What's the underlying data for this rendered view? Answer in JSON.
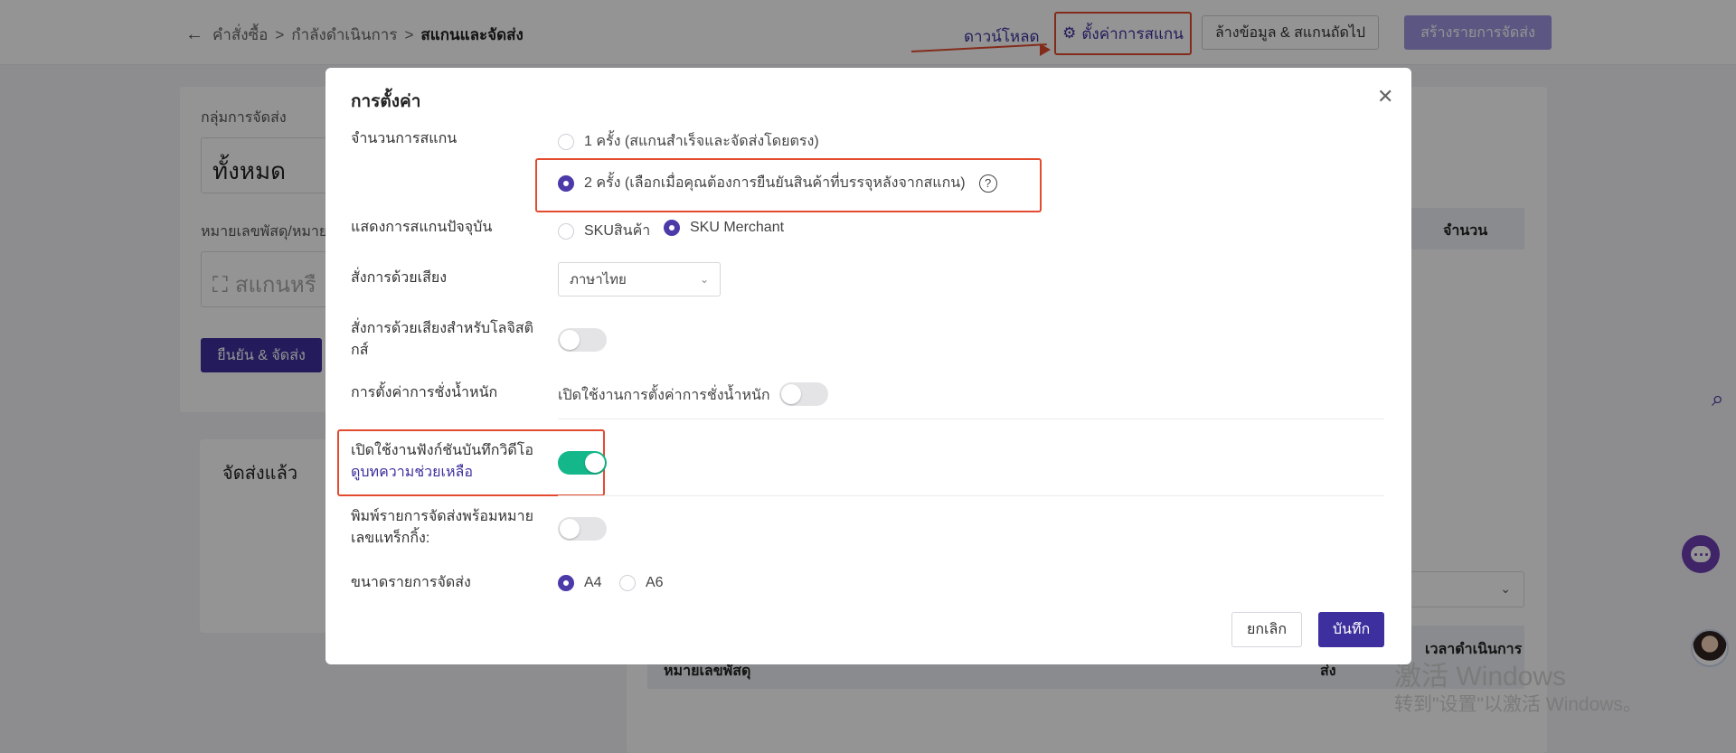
{
  "breadcrumb": {
    "items": [
      "คำสั่งซื้อ",
      "กำลังดำเนินการ",
      "สแกนและจัดส่ง"
    ]
  },
  "topbar": {
    "download_label": "ดาวน์โหลด",
    "scan_settings_label": "ตั้งค่าการสแกน",
    "clear_next_label": "ล้างข้อมูล & สแกนถัดไป",
    "create_shipment_label": "สร้างรายการจัดส่ง"
  },
  "background": {
    "group_label": "กลุ่มการจัดส่ง",
    "group_value": "ทั้งหมด",
    "parcel_label": "หมายเลขพัสดุ/หมายเ",
    "scan_placeholder": "สแกนหรื",
    "confirm_button": "ยืนยัน & จัดส่ง",
    "shipped_label": "จัดส่งแล้ว",
    "qty_header": "จำนวน",
    "parcel_header": "หมายเลขพัสดุ",
    "ship_header": "ส่ง",
    "time_header": "เวลาดำเนินการ",
    "watermark_line1": "激活 Windows",
    "watermark_line2": "转到\"设置\"以激活 Windows。"
  },
  "modal": {
    "title": "การตั้งค่า",
    "scan_count": {
      "label": "จำนวนการสแกน",
      "option1": "1 ครั้ง (สแกนสำเร็จและจัดส่งโดยตรง)",
      "option2": "2 ครั้ง (เลือกเมื่อคุณต้องการยืนยันสินค้าที่บรรจุหลังจากสแกน)",
      "selected": 2
    },
    "current_scan": {
      "label": "แสดงการสแกนปัจจุบัน",
      "option1": "SKUสินค้า",
      "option2": "SKU Merchant",
      "selected": 2
    },
    "voice": {
      "label": "สั่งการด้วยเสียง",
      "value": "ภาษาไทย"
    },
    "logistics_voice": {
      "label": "สั่งการด้วยเสียงสำหรับโลจิสติกส์",
      "enabled": false
    },
    "weighing": {
      "label": "การตั้งค่าการชั่งน้ำหนัก",
      "toggle_text": "เปิดใช้งานการตั้งค่าการชั่งน้ำหนัก",
      "enabled": false
    },
    "video": {
      "label": "เปิดใช้งานฟังก์ชันบันทึกวิดีโอ",
      "help_link": "ดูบทความช่วยเหลือ",
      "enabled": true
    },
    "print_tracking": {
      "label": "พิมพ์รายการจัดส่งพร้อมหมายเลขแทร็กกิ้ง:",
      "enabled": false
    },
    "paper_size": {
      "label": "ขนาดรายการจัดส่ง",
      "option1": "A4",
      "option2": "A6",
      "selected": 1
    },
    "cancel_label": "ยกเลิก",
    "save_label": "บันทึก"
  },
  "colors": {
    "primary": "#3d2f9e",
    "highlight": "#e24b30",
    "toggle_on": "#14b78a"
  },
  "icons": [
    "arrow-left-icon",
    "gear-icon",
    "close-icon",
    "question-icon",
    "chevron-down-icon",
    "scan-icon",
    "search-icon",
    "chat-icon"
  ]
}
